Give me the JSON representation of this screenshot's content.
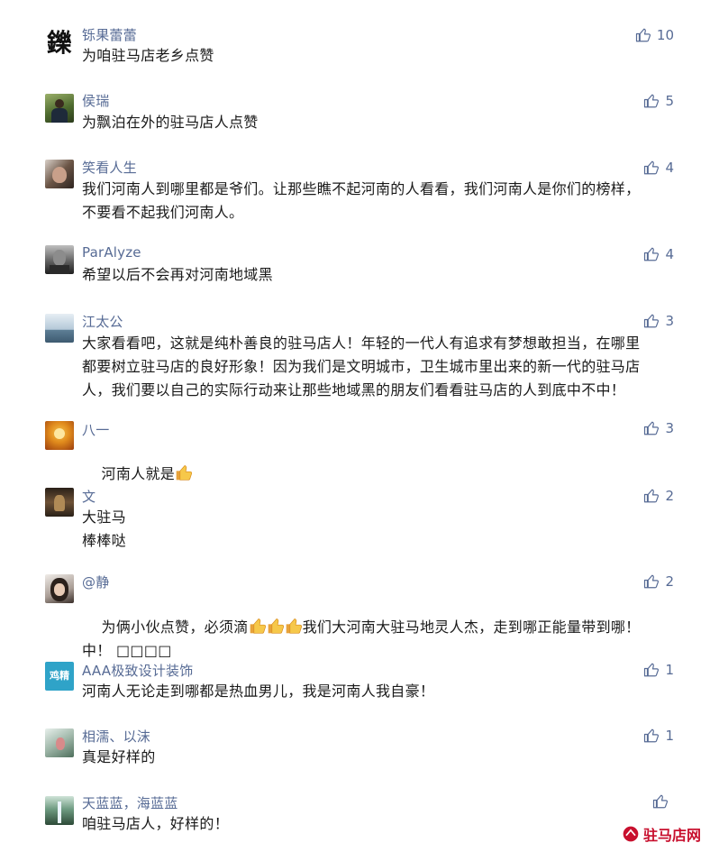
{
  "comments": [
    {
      "name": "铄果蕾蕾",
      "text": "为咱驻马店老乡点赞",
      "likes": "10",
      "avatar_char": "鑠"
    },
    {
      "name": "侯瑞",
      "text": "为飘泊在外的驻马店人点赞",
      "likes": "5"
    },
    {
      "name": "笑看人生",
      "text": "我们河南人到哪里都是爷们。让那些瞧不起河南的人看看，我们河南人是你们的榜样，\n不要看不起我们河南人。",
      "likes": "4"
    },
    {
      "name": "ParAlyze",
      "text": "希望以后不会再对河南地域黑",
      "likes": "4"
    },
    {
      "name": "江太公",
      "text": "大家看看吧，这就是纯朴善良的驻马店人！年轻的一代人有追求有梦想敢担当，在哪里\n都要树立驻马店的良好形象！因为我们是文明城市，卫生城市里出来的新一代的驻马店\n人，我们要以自己的实际行动来让那些地域黑的朋友们看看驻马店的人到底中不中！",
      "likes": "3"
    },
    {
      "name": "八一",
      "text": "河南人就是",
      "likes": "3"
    },
    {
      "name": "文",
      "text": "大驻马\n棒棒哒",
      "likes": "2"
    },
    {
      "name": "@静",
      "text_a": "为俩小伙点赞，必须滴",
      "text_b": "我们大河南大驻马地灵人杰，走到哪正能量带到哪！",
      "text_c": "中！ □□□□",
      "likes": "2"
    },
    {
      "name": "AAA极致设计装饰",
      "text": "河南人无论走到哪都是热血男儿，我是河南人我自豪！",
      "likes": "1",
      "avatar_text": "鸡精"
    },
    {
      "name": "相濡、以沫",
      "text": "真是好样的",
      "likes": "1"
    },
    {
      "name": "天蓝蓝，海蓝蓝",
      "text": "咱驻马店人，好样的！",
      "likes": ""
    }
  ],
  "watermark": {
    "text": "驻马店网"
  },
  "colors": {
    "name": "#576b95",
    "text": "#1a1a1a",
    "watermark": "#c8102e"
  }
}
